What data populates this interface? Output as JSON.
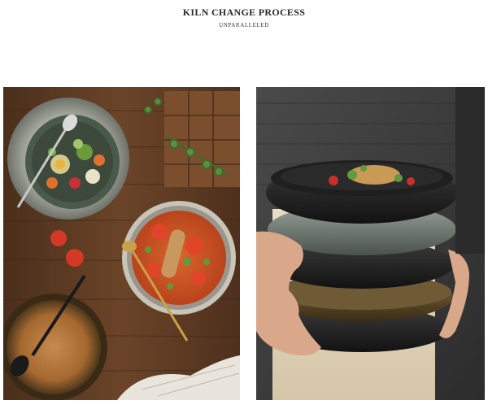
{
  "header": {
    "title": "KILN CHANGE PROCESS",
    "subtitle": "UNPARALLELED"
  },
  "images": {
    "left": {
      "icon": "tableware-photo-icon"
    },
    "right": {
      "icon": "stacked-bowls-photo-icon"
    }
  },
  "colors": {
    "background": "#ffffff",
    "wood": "#5a3a22",
    "glaze_grey": "#8f948c",
    "glaze_dark": "#222222",
    "glaze_amber": "#6a5330",
    "sweater": "#3d3d3d"
  }
}
